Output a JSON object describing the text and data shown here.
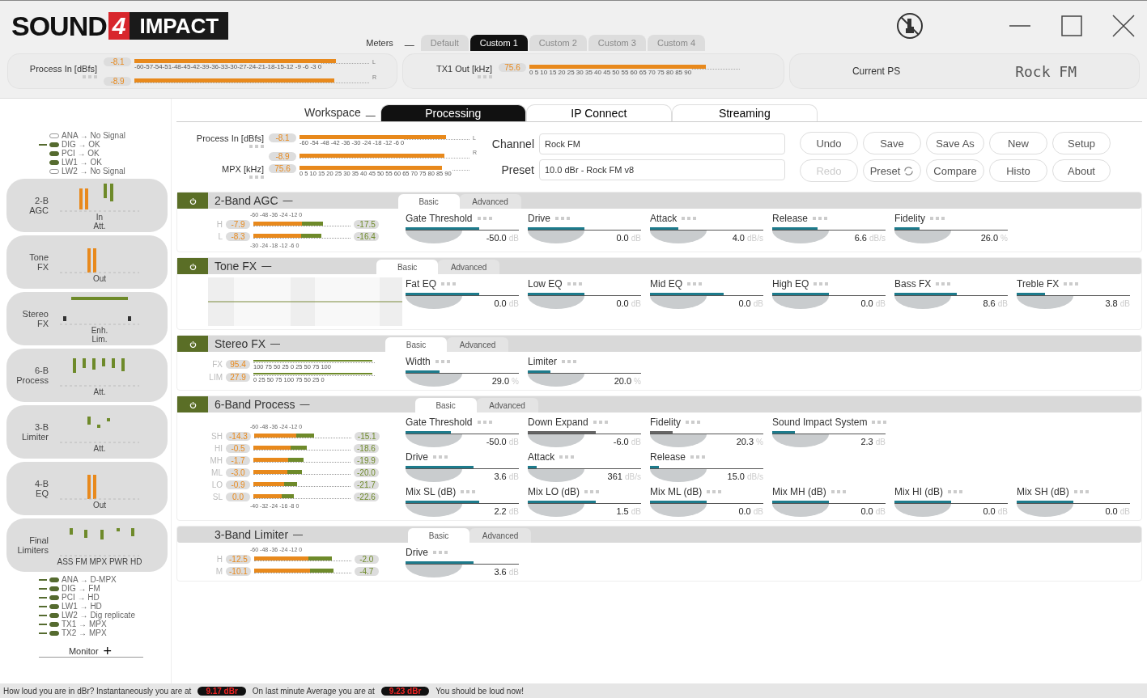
{
  "logo": {
    "word1": "SOUND",
    "badge": "4",
    "word2": "IMPACT"
  },
  "meters_bar": {
    "label": "Meters",
    "toggle": "—",
    "tabs": [
      {
        "label": "Default",
        "selected": false
      },
      {
        "label": "Custom 1",
        "selected": true
      },
      {
        "label": "Custom 2",
        "selected": false
      },
      {
        "label": "Custom 3",
        "selected": false
      },
      {
        "label": "Custom 4",
        "selected": false
      }
    ]
  },
  "header_meters": [
    {
      "label": "Process In [dBfs]",
      "scale": "-60-57-54-51-48-45-42-39-36-33-30-27-24-21-18-15-12 -9 -6 -3 0",
      "rows": [
        {
          "value": "-8.1",
          "level": 0.86,
          "channel": "L"
        },
        {
          "value": "-8.9",
          "level": 0.85,
          "channel": "R"
        }
      ]
    },
    {
      "label": "TX1 Out [kHz]",
      "scale": "0 5 10 15 20 25 30 35 40 45 50 55 60 65 70 75 80 85 90",
      "rows": [
        {
          "value": "75.6",
          "level": 0.84
        }
      ]
    }
  ],
  "current_ps": {
    "label": "Current PS",
    "value": "Rock FM"
  },
  "workspace": {
    "label": "Workspace",
    "toggle": "—",
    "tabs": [
      {
        "label": "Processing",
        "selected": true
      },
      {
        "label": "IP Connect",
        "selected": false
      },
      {
        "label": "Streaming",
        "selected": false
      }
    ]
  },
  "processing_meters": [
    {
      "label": "Process In [dBfs]",
      "scale": "-60 -54 -48 -42 -36 -30 -24 -18 -12 -6 0",
      "rows": [
        {
          "value": "-8.1",
          "level": 0.86,
          "channel": "L"
        },
        {
          "value": "-8.9",
          "level": 0.85,
          "channel": "R"
        }
      ]
    },
    {
      "label": "MPX [kHz]",
      "scale": "0 5 10 15 20 25 30 35 40 45 50 55 60 65 70 75 80 85 90",
      "rows": [
        {
          "value": "75.6",
          "level": 0.84
        }
      ]
    }
  ],
  "fields": [
    {
      "label": "Channel",
      "value": "Rock FM"
    },
    {
      "label": "Preset",
      "value": "10.0 dBr -  Rock FM v8"
    }
  ],
  "buttons": [
    {
      "label": "Undo",
      "disabled": false
    },
    {
      "label": "Save",
      "disabled": false
    },
    {
      "label": "Save As",
      "disabled": false
    },
    {
      "label": "New",
      "disabled": false
    },
    {
      "label": "Setup",
      "disabled": false
    },
    {
      "label": "Redo",
      "disabled": true
    },
    {
      "label": "Preset",
      "disabled": false,
      "kind": "refresh"
    },
    {
      "label": "Compare",
      "disabled": false
    },
    {
      "label": "Histo",
      "disabled": false
    },
    {
      "label": "About",
      "disabled": false
    }
  ],
  "inputs": [
    {
      "label": "ANA → No Signal",
      "on": false,
      "selected": false
    },
    {
      "label": "DIG → OK",
      "on": true,
      "selected": true
    },
    {
      "label": "PCI → OK",
      "on": true,
      "selected": false
    },
    {
      "label": "LW1 → OK",
      "on": true,
      "selected": false
    },
    {
      "label": "LW2 → No Signal",
      "on": false,
      "selected": false
    }
  ],
  "modules": [
    {
      "lines": [
        "2-B",
        "AGC"
      ],
      "kind": "agc",
      "captions": [
        "In",
        "Att."
      ]
    },
    {
      "lines": [
        "Tone",
        "FX"
      ],
      "kind": "out",
      "captions": [
        "Out"
      ]
    },
    {
      "lines": [
        "Stereo",
        "FX"
      ],
      "kind": "stereo",
      "captions": [
        "Enh.",
        "Lim."
      ]
    },
    {
      "lines": [
        "6-B",
        "Process"
      ],
      "kind": "att6",
      "captions": [
        "Att."
      ]
    },
    {
      "lines": [
        "3-B",
        "Limiter"
      ],
      "kind": "att3",
      "captions": [
        "Att."
      ]
    },
    {
      "lines": [
        "4-B",
        "EQ"
      ],
      "kind": "out",
      "captions": [
        "Out"
      ]
    },
    {
      "lines": [
        "Final",
        "Limiters"
      ],
      "kind": "final",
      "captions": [
        "ASS FM MPX PWR HD"
      ]
    }
  ],
  "outputs": [
    {
      "label": "ANA  → D-MPX",
      "on": true
    },
    {
      "label": "DIG  → FM",
      "on": true
    },
    {
      "label": "PCI  → HD",
      "on": true
    },
    {
      "label": "LW1  → HD",
      "on": true
    },
    {
      "label": "LW2  → Dig replicate",
      "on": true
    },
    {
      "label": "TX1  → MPX",
      "on": true
    },
    {
      "label": "TX2  → MPX",
      "on": true
    }
  ],
  "monitor": {
    "label": "Monitor",
    "toggle": "+"
  },
  "sections": [
    {
      "title": "2-Band AGC",
      "power": true,
      "toggle": "—",
      "tabs": [
        {
          "label": "Basic",
          "selected": true
        },
        {
          "label": "Advanced",
          "selected": false
        }
      ],
      "meter": {
        "kind": "bands",
        "scale_top": "-60 -48 -36 -24 -12 0",
        "scale_bottom": "-30 -24 -18 -12 -6 0",
        "rows": [
          {
            "band": "H",
            "in": "-7.9",
            "out": "-17.5",
            "level": 0.72
          },
          {
            "band": "L",
            "in": "-8.3",
            "out": "-16.4",
            "level": 0.7
          }
        ]
      },
      "knob_rows": [
        [
          {
            "label": "Gate Threshold",
            "value": "-50.0",
            "unit": "dB",
            "level": 0.65,
            "greyed": false
          },
          {
            "label": "Drive",
            "value": "0.0",
            "unit": "dB",
            "level": 0.5,
            "greyed": false
          },
          {
            "label": "Attack",
            "value": "4.0",
            "unit": "dB/s",
            "level": 0.25,
            "greyed": false
          },
          {
            "label": "Release",
            "value": "6.6",
            "unit": "dB/s",
            "level": 0.4,
            "greyed": false
          },
          {
            "label": "Fidelity",
            "value": "26.0",
            "unit": "%",
            "level": 0.22,
            "greyed": false
          }
        ]
      ]
    },
    {
      "title": "Tone FX",
      "power": true,
      "toggle": "—",
      "tabs": [
        {
          "label": "Basic",
          "selected": true
        },
        {
          "label": "Advanced",
          "selected": false
        }
      ],
      "meter": {
        "kind": "eq"
      },
      "knob_rows": [
        [
          {
            "label": "Fat EQ",
            "value": "0.0",
            "unit": "dB",
            "level": 0.65,
            "greyed": false
          },
          {
            "label": "Low EQ",
            "value": "0.0",
            "unit": "dB",
            "level": 0.5,
            "greyed": false
          },
          {
            "label": "Mid EQ",
            "value": "0.0",
            "unit": "dB",
            "level": 0.65,
            "greyed": false
          },
          {
            "label": "High EQ",
            "value": "0.0",
            "unit": "dB",
            "level": 0.5,
            "greyed": false
          },
          {
            "label": "Bass FX",
            "value": "8.6",
            "unit": "dB",
            "level": 0.55,
            "greyed": false
          },
          {
            "label": "Treble FX",
            "value": "3.8",
            "unit": "dB",
            "level": 0.25,
            "greyed": false
          }
        ]
      ]
    },
    {
      "title": "Stereo FX",
      "power": true,
      "toggle": "—",
      "tabs": [
        {
          "label": "Basic",
          "selected": true
        },
        {
          "label": "Advanced",
          "selected": false
        }
      ],
      "meter": {
        "kind": "stereo",
        "rows": [
          {
            "band": "FX",
            "in": "95.4",
            "scale": "100 75 50 25 0 25 50 75 100",
            "level": 0.98
          },
          {
            "band": "LIM",
            "in": "27.9",
            "scale": "0 25 50 75 100 75 50 25 0",
            "level": 0.98
          }
        ]
      },
      "knob_rows": [
        [
          {
            "label": "Width",
            "value": "29.0",
            "unit": "%",
            "level": 0.3,
            "greyed": false
          },
          {
            "label": "Limiter",
            "value": "20.0",
            "unit": "%",
            "level": 0.2,
            "greyed": false
          }
        ]
      ]
    },
    {
      "title": "6-Band Process",
      "power": true,
      "toggle": "—",
      "tabs": [
        {
          "label": "Basic",
          "selected": true
        },
        {
          "label": "Advanced",
          "selected": false
        }
      ],
      "meter": {
        "kind": "bands",
        "scale_top": "-60 -48 -36 -24 -12 0",
        "scale_bottom": "-40 -32 -24 -16 -8 0",
        "rows": [
          {
            "band": "SH",
            "in": "-14.3",
            "out": "-15.1",
            "level": 0.62
          },
          {
            "band": "HI",
            "in": "-0.5",
            "out": "-18.6",
            "level": 0.55
          },
          {
            "band": "MH",
            "in": "-1.7",
            "out": "-19.9",
            "level": 0.52
          },
          {
            "band": "ML",
            "in": "-3.0",
            "out": "-20.0",
            "level": 0.5
          },
          {
            "band": "LO",
            "in": "-0.9",
            "out": "-21.7",
            "level": 0.45
          },
          {
            "band": "SL",
            "in": "0.0",
            "out": "-22.6",
            "level": 0.42
          }
        ]
      },
      "knob_rows": [
        [
          {
            "label": "Gate Threshold",
            "value": "-50.0",
            "unit": "dB",
            "level": 0.4,
            "greyed": false
          },
          {
            "label": "Down Expand",
            "value": "-6.0",
            "unit": "dB",
            "level": 0.6,
            "greyed": true
          },
          {
            "label": "Fidelity",
            "value": "20.3",
            "unit": "%",
            "level": 0.2,
            "greyed": true
          },
          {
            "label": "Sound Impact System",
            "value": "2.3",
            "unit": "dB",
            "level": 0.2,
            "greyed": false
          }
        ],
        [
          {
            "label": "Drive",
            "value": "3.6",
            "unit": "dB",
            "level": 0.6,
            "greyed": false
          },
          {
            "label": "Attack",
            "value": "361",
            "unit": "dB/s",
            "level": 0.08,
            "greyed": false
          },
          {
            "label": "Release",
            "value": "15.0",
            "unit": "dB/s",
            "level": 0.08,
            "greyed": false
          }
        ],
        [
          {
            "label": "Mix SL (dB)",
            "value": "2.2",
            "unit": "dB",
            "level": 0.65,
            "greyed": false
          },
          {
            "label": "Mix LO (dB)",
            "value": "1.5",
            "unit": "dB",
            "level": 0.6,
            "greyed": false
          },
          {
            "label": "Mix ML (dB)",
            "value": "0.0",
            "unit": "dB",
            "level": 0.5,
            "greyed": false
          },
          {
            "label": "Mix MH (dB)",
            "value": "0.0",
            "unit": "dB",
            "level": 0.5,
            "greyed": false
          },
          {
            "label": "Mix HI (dB)",
            "value": "0.0",
            "unit": "dB",
            "level": 0.5,
            "greyed": false
          },
          {
            "label": "Mix SH (dB)",
            "value": "0.0",
            "unit": "dB",
            "level": 0.5,
            "greyed": false
          }
        ]
      ]
    },
    {
      "title": "3-Band Limiter",
      "power": false,
      "toggle": "—",
      "tabs": [
        {
          "label": "Basic",
          "selected": true
        },
        {
          "label": "Advanced",
          "selected": false
        }
      ],
      "meter": {
        "kind": "bands",
        "scale_top": "-60 -48 -36 -24 -12 0",
        "rows": [
          {
            "band": "H",
            "in": "-12.5",
            "out": "-2.0",
            "level": 0.8
          },
          {
            "band": "M",
            "in": "-10.1",
            "out": "-4.7",
            "level": 0.82
          }
        ]
      },
      "knob_rows": [
        [
          {
            "label": "Drive",
            "value": "3.6",
            "unit": "dB",
            "level": 0.6,
            "greyed": false
          }
        ]
      ]
    }
  ],
  "status_bar": {
    "parts": [
      {
        "kind": "text",
        "text": "How loud you are in dBr? Instantaneously you are at"
      },
      {
        "kind": "badge",
        "text": "9.17 dBr"
      },
      {
        "kind": "text",
        "text": "On last minute Average you are at"
      },
      {
        "kind": "badge",
        "text": "9.23 dBr"
      },
      {
        "kind": "text",
        "text": "You should be loud now!"
      }
    ]
  }
}
